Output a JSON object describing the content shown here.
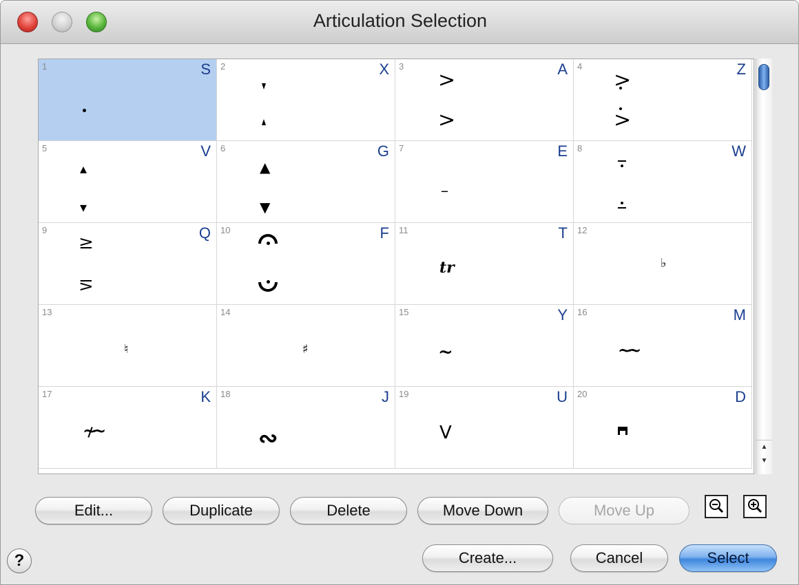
{
  "window": {
    "title": "Articulation Selection"
  },
  "cells": [
    {
      "num": "1",
      "key": "S",
      "selected": true
    },
    {
      "num": "2",
      "key": "X"
    },
    {
      "num": "3",
      "key": "A"
    },
    {
      "num": "4",
      "key": "Z"
    },
    {
      "num": "5",
      "key": "V"
    },
    {
      "num": "6",
      "key": "G"
    },
    {
      "num": "7",
      "key": "E"
    },
    {
      "num": "8",
      "key": "W"
    },
    {
      "num": "9",
      "key": "Q"
    },
    {
      "num": "10",
      "key": "F"
    },
    {
      "num": "11",
      "key": "T"
    },
    {
      "num": "12",
      "key": ""
    },
    {
      "num": "13",
      "key": ""
    },
    {
      "num": "14",
      "key": ""
    },
    {
      "num": "15",
      "key": "Y"
    },
    {
      "num": "16",
      "key": "M"
    },
    {
      "num": "17",
      "key": "K"
    },
    {
      "num": "18",
      "key": "J"
    },
    {
      "num": "19",
      "key": "U"
    },
    {
      "num": "20",
      "key": "D"
    }
  ],
  "symbols": {
    "s3a": ">",
    "s3b": ">",
    "s4b": ">",
    "s5a": "▴",
    "s5b": "▾",
    "s6a": "▲",
    "s6b": "▼",
    "s7": "–",
    "s9a": "≥",
    "s9b": "≤",
    "s10a": "𝄐",
    "s10b": "𝄑",
    "s11": "tr",
    "s15": "~",
    "s18": "∾",
    "s19": "V"
  },
  "buttons": {
    "edit": "Edit...",
    "duplicate": "Duplicate",
    "delete": "Delete",
    "move_down": "Move Down",
    "move_up": "Move Up",
    "create": "Create...",
    "cancel": "Cancel",
    "select": "Select",
    "help": "?"
  },
  "scroll": {
    "up": "▲",
    "down": "▼"
  },
  "colors": {
    "selection": "#b5cff0",
    "key_letter": "#1a3e8f",
    "default_button": "#3f86dd"
  }
}
